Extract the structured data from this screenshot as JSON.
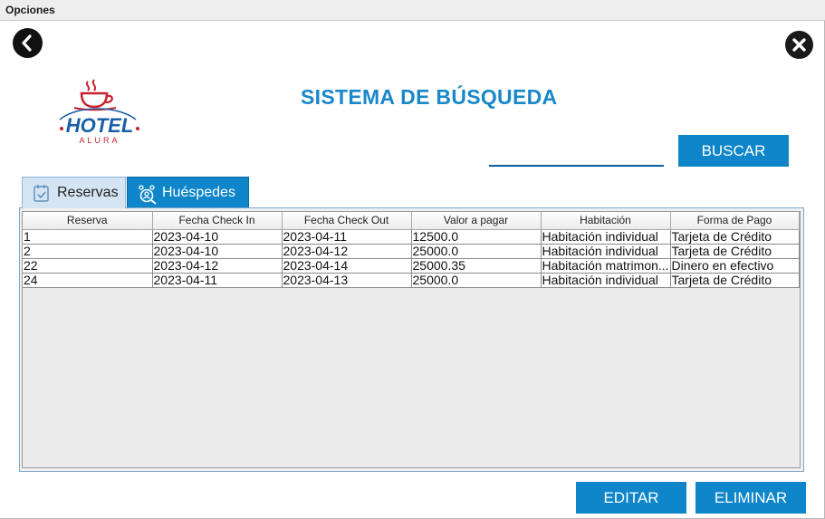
{
  "window": {
    "title": "Opciones"
  },
  "header": {
    "title": "SISTEMA DE BÚSQUEDA",
    "logo_text": "HOTEL",
    "logo_subtext": "ALURA"
  },
  "search": {
    "value": "",
    "placeholder": "",
    "button_label": "BUSCAR"
  },
  "tabs": [
    {
      "label": "Reservas",
      "icon": "calendar-check-icon",
      "selected": true
    },
    {
      "label": "Huéspedes",
      "icon": "guests-search-icon",
      "selected": false
    }
  ],
  "table": {
    "columns": [
      "Reserva",
      "Fecha Check In",
      "Fecha Check Out",
      "Valor a pagar",
      "Habitación",
      "Forma de Pago"
    ],
    "rows": [
      [
        "1",
        "2023-04-10",
        "2023-04-11",
        "12500.0",
        "Habitación individual",
        "Tarjeta de Crédito"
      ],
      [
        "2",
        "2023-04-10",
        "2023-04-12",
        "25000.0",
        "Habitación individual",
        "Tarjeta de Crédito"
      ],
      [
        "22",
        "2023-04-12",
        "2023-04-14",
        "25000.35",
        "Habitación matrimon...",
        "Dinero en efectivo"
      ],
      [
        "24",
        "2023-04-11",
        "2023-04-13",
        "25000.0",
        "Habitación individual",
        "Tarjeta de Crédito"
      ]
    ]
  },
  "actions": {
    "edit_label": "EDITAR",
    "delete_label": "ELIMINAR"
  },
  "colors": {
    "accent": "#0e86c9",
    "title": "#1a87c9",
    "logo_red": "#c8202f",
    "logo_blue": "#1b5fa8"
  }
}
